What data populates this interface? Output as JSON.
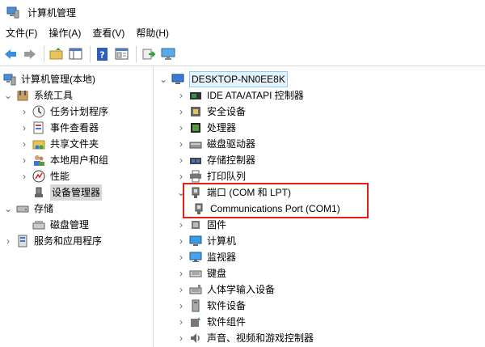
{
  "window": {
    "title": "计算机管理"
  },
  "menu": [
    "文件(F)",
    "操作(A)",
    "查看(V)",
    "帮助(H)"
  ],
  "toolbar": {
    "icons": [
      "back-icon",
      "forward-icon",
      "up-folder-icon",
      "show-hide-tree-icon",
      "help-icon",
      "properties-icon",
      "export-icon",
      "monitor-icon"
    ]
  },
  "left_tree": {
    "root": "计算机管理(本地)",
    "system_tools": "系统工具",
    "task_scheduler": "任务计划程序",
    "event_viewer": "事件查看器",
    "shared_folders": "共享文件夹",
    "local_users": "本地用户和组",
    "performance": "性能",
    "device_manager": "设备管理器",
    "storage": "存储",
    "disk_management": "磁盘管理",
    "services_apps": "服务和应用程序"
  },
  "device_tree": {
    "root": "DESKTOP-NN0EE8K",
    "ide": "IDE ATA/ATAPI 控制器",
    "security": "安全设备",
    "processor": "处理器",
    "disk_drives": "磁盘驱动器",
    "storage_ctrl": "存储控制器",
    "print_queue": "打印队列",
    "ports": "端口 (COM 和 LPT)",
    "com_port": "Communications Port (COM1)",
    "firmware": "固件",
    "computer": "计算机",
    "monitors": "监视器",
    "keyboard": "键盘",
    "hid": "人体学输入设备",
    "software_devices": "软件设备",
    "software_components": "软件组件",
    "sound": "声音、视频和游戏控制器"
  },
  "colors": {
    "highlight_border": "#e0201b",
    "selection": "#d9d9d9",
    "root_selection": "#e5f3ff"
  }
}
